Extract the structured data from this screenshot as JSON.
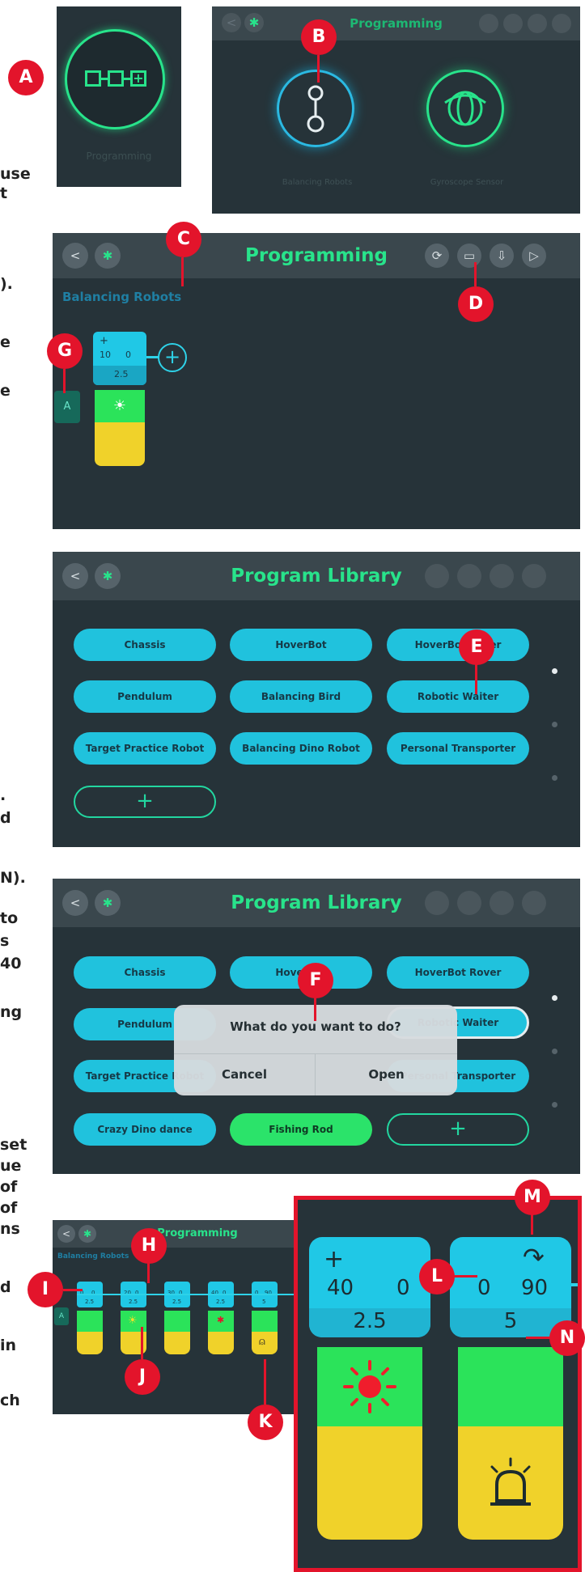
{
  "colors": {
    "accent_green": "#28e38b",
    "cyan": "#20c8e6",
    "panel": "#263339",
    "callout": "#e3142b"
  },
  "side_text": {
    "line1": "use",
    "line2": "t",
    "line3": ").",
    "line4": "e",
    "line5": "e",
    "line6": ".",
    "line7": "d",
    "line8": "N).",
    "line9": "to",
    "line10": "s",
    "line11": "40",
    "line12": "ng",
    "line13": "set",
    "line14": "ue",
    "line15": "of",
    "line16": "of",
    "line17": "ns",
    "line18": "d",
    "line19": "in",
    "line20": "ch"
  },
  "callouts": {
    "a": "A",
    "b": "B",
    "c": "C",
    "d": "D",
    "e": "E",
    "f": "F",
    "g": "G",
    "h": "H",
    "i": "I",
    "j": "J",
    "k": "K",
    "l": "L",
    "m": "M",
    "n": "N"
  },
  "panel1": {
    "label": "Programming"
  },
  "panel2": {
    "title": "Programming",
    "item1": "Balancing Robots",
    "item2": "Gyroscope Sensor"
  },
  "panel3": {
    "title": "Programming",
    "subtitle": "Balancing Robots",
    "tab_label": "A",
    "block": {
      "op": "+",
      "a": "10",
      "b": "0",
      "c": "2.5"
    }
  },
  "panel4": {
    "title": "Program Library",
    "programs": [
      "Chassis",
      "HoverBot",
      "HoverBot Rover",
      "Pendulum",
      "Balancing Bird",
      "Robotic Waiter",
      "Target Practice Robot",
      "Balancing Dino Robot",
      "Personal Transporter"
    ],
    "add": "+"
  },
  "panel5": {
    "title": "Program Library",
    "programs": [
      "Chassis",
      "HoverBot",
      "HoverBot Rover",
      "Pendulum",
      "Robotic Waiter",
      "Target Practice Robot",
      "Personal Transporter",
      "Crazy Dino dance",
      "Fishing Rod"
    ],
    "add": "+",
    "dialog": {
      "question": "What do you want to do?",
      "cancel": "Cancel",
      "open": "Open"
    }
  },
  "panel6": {
    "title": "Programming",
    "subtitle": "Balancing Robots",
    "tab_label": "A",
    "blocks": [
      {
        "a": "0",
        "b": "0",
        "c": "2.5"
      },
      {
        "a": "20",
        "b": "0",
        "c": "2.5"
      },
      {
        "a": "30",
        "b": "0",
        "c": "2.5"
      },
      {
        "a": "40",
        "b": "0",
        "c": "2.5"
      },
      {
        "a": "0",
        "b": "90",
        "c": "5"
      }
    ]
  },
  "zoom": {
    "block1": {
      "op": "+",
      "a": "40",
      "b": "0",
      "c": "2.5"
    },
    "block2": {
      "op": "↷",
      "a": "0",
      "b": "90",
      "c": "5"
    }
  }
}
